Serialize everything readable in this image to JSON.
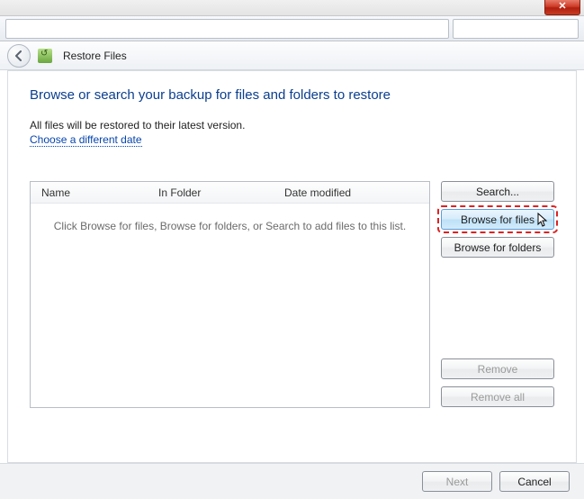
{
  "window": {
    "close_symbol": "✕"
  },
  "nav": {
    "title": "Restore Files"
  },
  "main": {
    "heading": "Browse or search your backup for files and folders to restore",
    "info": "All files will be restored to their latest version.",
    "link": "Choose a different date"
  },
  "list": {
    "columns": {
      "name": "Name",
      "folder": "In Folder",
      "date": "Date modified"
    },
    "empty_text": "Click Browse for files, Browse for folders, or Search to add files to this list."
  },
  "buttons": {
    "search": "Search...",
    "browse_files": "Browse for files",
    "browse_folders": "Browse for folders",
    "remove": "Remove",
    "remove_all": "Remove all"
  },
  "footer": {
    "next": "Next",
    "cancel": "Cancel"
  }
}
